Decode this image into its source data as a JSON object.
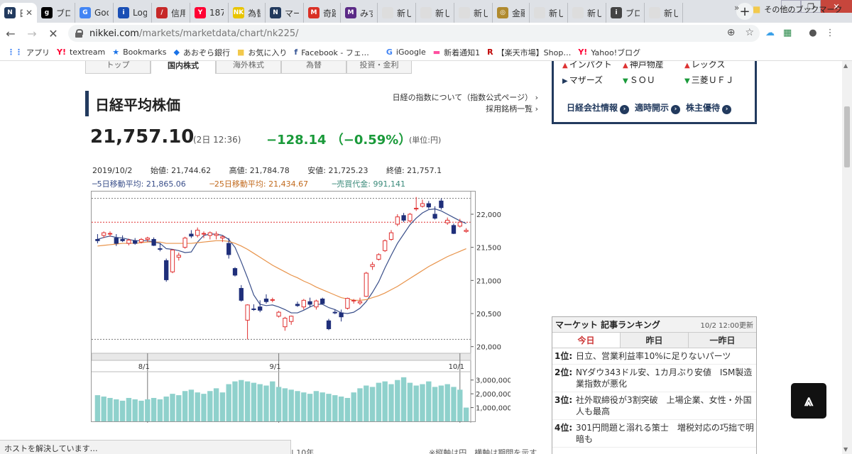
{
  "browser": {
    "tabs": [
      {
        "label": "日",
        "icon_color": "#223a5e",
        "icon_text": "N",
        "active": true
      },
      {
        "label": "ブロ",
        "icon_color": "#000000",
        "icon_text": "g"
      },
      {
        "label": "Goo",
        "icon_color": "#4285f4",
        "icon_text": "G"
      },
      {
        "label": "Log",
        "icon_color": "#1a4fb5",
        "icon_text": "i"
      },
      {
        "label": "信用",
        "icon_color": "#c62828",
        "icon_text": "/"
      },
      {
        "label": "187",
        "icon_color": "#ff0033",
        "icon_text": "Y"
      },
      {
        "label": "為替",
        "icon_color": "#e8c400",
        "icon_text": "NK"
      },
      {
        "label": "マー",
        "icon_color": "#223a5e",
        "icon_text": "N"
      },
      {
        "label": "奇跡",
        "icon_color": "#d93025",
        "icon_text": "M"
      },
      {
        "label": "みず",
        "icon_color": "#5b2a86",
        "icon_text": "M"
      },
      {
        "label": "新しい",
        "icon_color": "#dddddd",
        "icon_text": ""
      },
      {
        "label": "新しい",
        "icon_color": "#dddddd",
        "icon_text": ""
      },
      {
        "label": "新しい",
        "icon_color": "#dddddd",
        "icon_text": ""
      },
      {
        "label": "金融",
        "icon_color": "#b08a2e",
        "icon_text": "◎"
      },
      {
        "label": "新しい",
        "icon_color": "#dddddd",
        "icon_text": ""
      },
      {
        "label": "新しい",
        "icon_color": "#dddddd",
        "icon_text": ""
      },
      {
        "label": "ブロ",
        "icon_color": "#444444",
        "icon_text": "i"
      },
      {
        "label": "新しい",
        "icon_color": "#dddddd",
        "icon_text": ""
      }
    ],
    "new_tab": "+",
    "url_host": "nikkei.com",
    "url_path": "/markets/marketdata/chart/nk225/",
    "bookmarks": [
      {
        "label": "アプリ",
        "icon": "⋮⋮",
        "icon_color": "#4285f4"
      },
      {
        "label": "textream",
        "icon": "Y!",
        "icon_color": "#ff0033"
      },
      {
        "label": "Bookmarks",
        "icon": "★",
        "icon_color": "#1a73e8"
      },
      {
        "label": "あおぞら銀行",
        "icon": "◆",
        "icon_color": "#1a73e8"
      },
      {
        "label": "お気に入り",
        "icon": "■",
        "icon_color": "#f2c94c"
      },
      {
        "label": "Facebook - フェ…",
        "icon": "f",
        "icon_color": "#3b5998"
      },
      {
        "label": "iGoogle",
        "icon": "G",
        "icon_color": "#4285f4"
      },
      {
        "label": "新着通知1",
        "icon": "▬",
        "icon_color": "#ff4fa0"
      },
      {
        "label": "【楽天市場】Shop…",
        "icon": "R",
        "icon_color": "#bf0000"
      },
      {
        "label": "Yahoo!ブログ",
        "icon": "Y!",
        "icon_color": "#ff0033"
      }
    ],
    "bookmarks_more": "»",
    "other_bookmarks": "その他のブックマーク",
    "status_text": "ホストを解決しています…"
  },
  "page": {
    "subtabs": [
      "トップ",
      "国内株式",
      "海外株式",
      "為替",
      "投資・金利"
    ],
    "title": "日経平均株価",
    "links": [
      "日経の指数について（指数公式ページ） ›",
      "採用銘柄一覧 ›"
    ],
    "price": "21,757.10",
    "price_time": "(2日 12:36)",
    "price_change": "−128.14 （−0.59%）",
    "unit": "(単位:円)",
    "ohlc": {
      "date": "2019/10/2",
      "open": "始値: 21,744.62",
      "high": "高値: 21,784.78",
      "low": "安値: 21,725.23",
      "close": "終値: 21,757.1"
    },
    "ma": {
      "ma5": "─5日移動平均: 21,865.06",
      "ma25": "─25日移動平均: 21,434.67",
      "volume": "─売買代金: 991,141"
    },
    "note_left": "| 10年",
    "note_right": "※縦軸は円、横軸は期間を示す"
  },
  "right": {
    "stocks": [
      {
        "mark": "▲",
        "dir": "up",
        "name": "インパクト"
      },
      {
        "mark": "▲",
        "dir": "up",
        "name": "神戸物産"
      },
      {
        "mark": "▲",
        "dir": "up",
        "name": "レックス"
      },
      {
        "mark": "▶",
        "dir": "nt",
        "name": "マザーズ"
      },
      {
        "mark": "▼",
        "dir": "dn",
        "name": "ＳＯＵ"
      },
      {
        "mark": "▼",
        "dir": "dn",
        "name": "三菱ＵＦＪ"
      }
    ],
    "links": [
      "日経会社情報",
      "適時開示",
      "株主優待"
    ],
    "ranking": {
      "title": "マーケット 記事ランキング",
      "updated": "10/2 12:00更新",
      "tabs": [
        "今日",
        "昨日",
        "一昨日"
      ],
      "items": [
        {
          "rank": "1位:",
          "text": "日立、営業利益率10%に足りないパーツ"
        },
        {
          "rank": "2位:",
          "text": "NYダウ343ドル安、1カ月ぶり安値　ISM製造業指数が悪化"
        },
        {
          "rank": "3位:",
          "text": "社外取締役が3割突破　上場企業、女性・外国人も最高"
        },
        {
          "rank": "4位:",
          "text": "301円問題と溺れる策士　増税対応の巧拙で明暗も"
        }
      ]
    }
  },
  "chart_data": {
    "type": "candlestick",
    "title": "",
    "xlabel": "",
    "ylabel": "",
    "x_ticks": [
      "8/1",
      "9/1",
      "10/1"
    ],
    "y_ticks": [
      20000,
      20500,
      21000,
      21500,
      22000
    ],
    "y_tick_labels": [
      "20,000",
      "20,500",
      "21,000",
      "21,500",
      "22,000"
    ],
    "ylim": [
      19900,
      22300
    ],
    "reference_lines": {
      "upper": 22240,
      "lower": 20110,
      "current": 21880
    },
    "candles": [
      {
        "o": 21620,
        "h": 21700,
        "l": 21560,
        "c": 21600
      },
      {
        "o": 21680,
        "h": 21740,
        "l": 21640,
        "c": 21720
      },
      {
        "o": 21700,
        "h": 21740,
        "l": 21660,
        "c": 21710
      },
      {
        "o": 21640,
        "h": 21700,
        "l": 21520,
        "c": 21560
      },
      {
        "o": 21620,
        "h": 21680,
        "l": 21580,
        "c": 21600
      },
      {
        "o": 21560,
        "h": 21630,
        "l": 21530,
        "c": 21610
      },
      {
        "o": 21600,
        "h": 21640,
        "l": 21540,
        "c": 21560
      },
      {
        "o": 21580,
        "h": 21640,
        "l": 21560,
        "c": 21620
      },
      {
        "o": 21620,
        "h": 21660,
        "l": 21580,
        "c": 21640
      },
      {
        "o": 21620,
        "h": 21650,
        "l": 21520,
        "c": 21530
      },
      {
        "o": 21480,
        "h": 21560,
        "l": 21440,
        "c": 21470
      },
      {
        "o": 21300,
        "h": 21330,
        "l": 20980,
        "c": 21010
      },
      {
        "o": 21130,
        "h": 21470,
        "l": 21110,
        "c": 21460
      },
      {
        "o": 21350,
        "h": 21420,
        "l": 21300,
        "c": 21380
      },
      {
        "o": 21500,
        "h": 21660,
        "l": 21480,
        "c": 21640
      },
      {
        "o": 21700,
        "h": 21760,
        "l": 21640,
        "c": 21670
      },
      {
        "o": 21680,
        "h": 21800,
        "l": 21650,
        "c": 21760
      },
      {
        "o": 21700,
        "h": 21740,
        "l": 21640,
        "c": 21710
      },
      {
        "o": 21680,
        "h": 21740,
        "l": 21620,
        "c": 21720
      },
      {
        "o": 21680,
        "h": 21740,
        "l": 21620,
        "c": 21700
      },
      {
        "o": 21640,
        "h": 21680,
        "l": 21580,
        "c": 21660
      },
      {
        "o": 21560,
        "h": 21640,
        "l": 21330,
        "c": 21390
      },
      {
        "o": 21180,
        "h": 21200,
        "l": 21060,
        "c": 21080
      },
      {
        "o": 20880,
        "h": 20930,
        "l": 20680,
        "c": 20700
      },
      {
        "o": 20400,
        "h": 20640,
        "l": 20110,
        "c": 20630
      },
      {
        "o": 20570,
        "h": 20640,
        "l": 20540,
        "c": 20560
      },
      {
        "o": 20600,
        "h": 20700,
        "l": 20520,
        "c": 20550
      },
      {
        "o": 20720,
        "h": 20790,
        "l": 20650,
        "c": 20680
      },
      {
        "o": 20700,
        "h": 20740,
        "l": 20670,
        "c": 20710
      },
      {
        "o": 20460,
        "h": 20540,
        "l": 20440,
        "c": 20520
      },
      {
        "o": 20300,
        "h": 20450,
        "l": 20240,
        "c": 20430
      },
      {
        "o": 20380,
        "h": 20470,
        "l": 20330,
        "c": 20460
      },
      {
        "o": 20640,
        "h": 20680,
        "l": 20600,
        "c": 20620
      },
      {
        "o": 20600,
        "h": 20720,
        "l": 20560,
        "c": 20700
      },
      {
        "o": 20680,
        "h": 20740,
        "l": 20600,
        "c": 20640
      },
      {
        "o": 20600,
        "h": 20710,
        "l": 20560,
        "c": 20690
      },
      {
        "o": 20720,
        "h": 20740,
        "l": 20640,
        "c": 20650
      },
      {
        "o": 20390,
        "h": 20420,
        "l": 20250,
        "c": 20270
      },
      {
        "o": 20520,
        "h": 20560,
        "l": 20490,
        "c": 20510
      },
      {
        "o": 20510,
        "h": 20560,
        "l": 20380,
        "c": 20450
      },
      {
        "o": 20580,
        "h": 20740,
        "l": 20560,
        "c": 20730
      },
      {
        "o": 20690,
        "h": 20720,
        "l": 20650,
        "c": 20700
      },
      {
        "o": 20660,
        "h": 20740,
        "l": 20630,
        "c": 20680
      },
      {
        "o": 20760,
        "h": 21130,
        "l": 20750,
        "c": 21110
      },
      {
        "o": 21210,
        "h": 21280,
        "l": 21160,
        "c": 21240
      },
      {
        "o": 21320,
        "h": 21410,
        "l": 21300,
        "c": 21390
      },
      {
        "o": 21450,
        "h": 21620,
        "l": 21430,
        "c": 21600
      },
      {
        "o": 21620,
        "h": 21760,
        "l": 21600,
        "c": 21720
      },
      {
        "o": 21850,
        "h": 22000,
        "l": 21820,
        "c": 21960
      },
      {
        "o": 21980,
        "h": 22020,
        "l": 21880,
        "c": 21910
      },
      {
        "o": 21900,
        "h": 22020,
        "l": 21880,
        "c": 22000
      },
      {
        "o": 22080,
        "h": 22260,
        "l": 22050,
        "c": 22090
      },
      {
        "o": 22120,
        "h": 22220,
        "l": 22100,
        "c": 22160
      },
      {
        "o": 22160,
        "h": 22200,
        "l": 22080,
        "c": 22110
      },
      {
        "o": 22000,
        "h": 22120,
        "l": 21920,
        "c": 21940
      },
      {
        "o": 22200,
        "h": 22240,
        "l": 22070,
        "c": 22100
      },
      {
        "o": 21870,
        "h": 21950,
        "l": 21840,
        "c": 21910
      },
      {
        "o": 21830,
        "h": 21860,
        "l": 21700,
        "c": 21710
      },
      {
        "o": 21820,
        "h": 21930,
        "l": 21800,
        "c": 21880
      },
      {
        "o": 21740,
        "h": 21790,
        "l": 21720,
        "c": 21757
      }
    ],
    "ma5": [
      21620,
      21650,
      21670,
      21650,
      21640,
      21620,
      21600,
      21600,
      21600,
      21580,
      21560,
      21480,
      21470,
      21450,
      21420,
      21430,
      21580,
      21680,
      21700,
      21700,
      21680,
      21620,
      21500,
      21280,
      21040,
      20780,
      20640,
      20620,
      20630,
      20600,
      20560,
      20510,
      20510,
      20550,
      20600,
      20640,
      20640,
      20590,
      20560,
      20510,
      20500,
      20520,
      20580,
      20680,
      20820,
      20980,
      21190,
      21380,
      21560,
      21700,
      21840,
      21940,
      22020,
      22070,
      22080,
      22050,
      22000,
      21950,
      21900,
      21860
    ],
    "ma25": [
      21520,
      21530,
      21540,
      21550,
      21560,
      21560,
      21560,
      21570,
      21580,
      21580,
      21580,
      21560,
      21560,
      21560,
      21560,
      21560,
      21570,
      21580,
      21590,
      21600,
      21600,
      21590,
      21560,
      21520,
      21470,
      21410,
      21350,
      21290,
      21230,
      21180,
      21130,
      21080,
      21040,
      20990,
      20950,
      20900,
      20860,
      20820,
      20780,
      20740,
      20720,
      20700,
      20700,
      20710,
      20740,
      20770,
      20810,
      20860,
      20910,
      20970,
      21030,
      21090,
      21150,
      21210,
      21260,
      21310,
      21360,
      21400,
      21440,
      21480
    ],
    "volume_ylim": [
      0,
      3500000
    ],
    "volume_ticks": [
      1000000,
      2000000,
      3000000
    ],
    "volume_tick_labels": [
      "1,000,000",
      "2,000,000",
      "3,000,000"
    ],
    "volume": [
      1900000,
      1800000,
      1700000,
      1600000,
      1500000,
      1700000,
      1600000,
      1500000,
      1600000,
      1700000,
      1600000,
      1800000,
      2000000,
      1900000,
      2200000,
      2300000,
      2100000,
      2000000,
      2200000,
      2400000,
      2100000,
      2700000,
      2900000,
      3000000,
      2900000,
      2800000,
      2700000,
      2600000,
      2900000,
      2500000,
      2400000,
      2300000,
      2200000,
      2100000,
      2000000,
      2200000,
      2100000,
      2000000,
      1900000,
      1800000,
      1700000,
      2100000,
      2400000,
      2600000,
      2500000,
      2800000,
      2900000,
      2700000,
      3000000,
      3200000,
      2800000,
      2600000,
      2700000,
      2900000,
      2500000,
      2600000,
      2700000,
      2500000,
      2300000,
      1000000
    ]
  }
}
